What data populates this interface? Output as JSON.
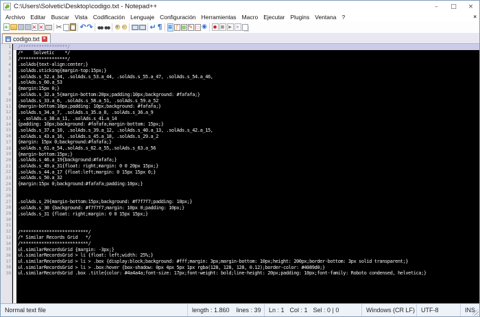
{
  "window": {
    "title": "C:\\Users\\Solvetic\\Desktop\\codigo.txt - Notepad++",
    "minimize": "–",
    "maximize": "□",
    "close": "×"
  },
  "menu": {
    "items": [
      "Archivo",
      "Editar",
      "Buscar",
      "Vista",
      "Codificación",
      "Lenguaje",
      "Configuración",
      "Herramientas",
      "Macro",
      "Ejecutar",
      "Plugins",
      "Ventana",
      "?"
    ],
    "close": "×"
  },
  "toolbar": {
    "groups": [
      [
        {
          "name": "new-file-icon",
          "type": "t-page",
          "glyph": "+",
          "color": "#2db82d"
        },
        {
          "name": "open-file-icon",
          "type": "t-folder",
          "glyph": "",
          "color": ""
        },
        {
          "name": "save-icon",
          "type": "t-floppy",
          "glyph": "",
          "color": ""
        },
        {
          "name": "save-all-icon",
          "type": "t-floppy",
          "glyph": "",
          "color": ""
        },
        {
          "name": "close-file-icon",
          "type": "t-page",
          "glyph": "×",
          "color": "#d43c3c"
        },
        {
          "name": "close-all-icon",
          "type": "t-page",
          "glyph": "×",
          "color": "#d43c3c"
        },
        {
          "name": "print-icon",
          "type": "t-printer",
          "glyph": "",
          "color": ""
        }
      ],
      [
        {
          "name": "cut-icon",
          "type": "t-plain",
          "glyph": "✂",
          "color": "#4a4f56"
        },
        {
          "name": "copy-icon",
          "type": "t-copy",
          "glyph": "",
          "color": ""
        },
        {
          "name": "paste-icon",
          "type": "t-paste",
          "glyph": "",
          "color": ""
        }
      ],
      [
        {
          "name": "undo-icon",
          "type": "t-plain",
          "glyph": "↶",
          "color": "#3a6fd8"
        },
        {
          "name": "redo-icon",
          "type": "t-plain",
          "glyph": "↷",
          "color": "#3a6fd8"
        }
      ],
      [
        {
          "name": "find-icon",
          "type": "t-binoc",
          "glyph": "",
          "color": ""
        },
        {
          "name": "replace-icon",
          "type": "t-binoc",
          "glyph": "",
          "color": ""
        }
      ],
      [
        {
          "name": "zoom-in-icon",
          "type": "t-mag",
          "glyph": "+",
          "color": "#444444"
        },
        {
          "name": "zoom-out-icon",
          "type": "t-mag",
          "glyph": "−",
          "color": "#444444"
        }
      ],
      [
        {
          "name": "sync-vertical-scroll-icon",
          "type": "t-monitor",
          "glyph": "",
          "color": ""
        },
        {
          "name": "sync-horizontal-scroll-icon",
          "type": "t-monitor",
          "glyph": "",
          "color": ""
        }
      ],
      [
        {
          "name": "word-wrap-icon",
          "type": "t-plain",
          "glyph": "↵",
          "color": "#2d6fd8"
        },
        {
          "name": "show-all-characters-icon",
          "type": "t-plain",
          "glyph": "¶",
          "color": "#2d6fd8"
        }
      ],
      [
        {
          "name": "indent-guide-icon",
          "type": "t-active",
          "glyph": "≡",
          "color": "#2d6fd8"
        },
        {
          "name": "function-list-icon",
          "type": "t-panel",
          "glyph": "ƒ",
          "color": "#e8892c"
        },
        {
          "name": "document-map-icon",
          "type": "t-panel",
          "glyph": "▦",
          "color": "#7ab648"
        },
        {
          "name": "document-switcher-icon",
          "type": "t-panel",
          "glyph": "✎",
          "color": "#d04545"
        },
        {
          "name": "folder-as-workspace-icon",
          "type": "t-panel",
          "glyph": "▭",
          "color": "#e08a8a"
        },
        {
          "name": "monitoring-icon",
          "type": "t-eye",
          "glyph": "◉",
          "color": "#2d6fd8"
        }
      ],
      [
        {
          "name": "macro-record-icon",
          "type": "t-btn",
          "glyph": "●",
          "color": "#cc2222"
        },
        {
          "name": "macro-stop-icon",
          "type": "t-btn",
          "glyph": "■",
          "color": "#9a9a9a"
        },
        {
          "name": "macro-play-icon",
          "type": "t-btn",
          "glyph": "▶",
          "color": "#7a7a7a"
        },
        {
          "name": "macro-run-multiple-icon",
          "type": "t-btn",
          "glyph": "»",
          "color": "#2d6fd8"
        },
        {
          "name": "macro-save-icon",
          "type": "t-copy",
          "glyph": "",
          "color": ""
        }
      ]
    ]
  },
  "tab": {
    "label": "codigo.txt",
    "close": "×"
  },
  "editor": {
    "current_line": 1,
    "lines": [
      "/******************/",
      "/*    Solvetic    */",
      "/******************/",
      ".solAds{text-align:center;}",
      ".solAds.sticking{margin-top:15px;}",
      ".solAds.s_52.a_34, .solAds.s_53.a_44, .solAds.s_55.a_47, .solAds.s_54.a_46,",
      ".solAds.s_60.a_53",
      "{margin:15px 0;}",
      ".solAds.s_32.a_5{margin-bottom:20px;padding:10px;background: #fafafa;}",
      ".solAds.s_33.a_6, .solAds.s_58.a_51, .solAds.s_59.a_52",
      "{margin-bottom:10px;padding: 10px;background: #fafafa;}",
      ".solAds.s_34.a_7, .solAds.s_35.a_8, .solAds.s_36.a_9",
      ", .solAds.s_38.a_11, .solAds.s_41.a_14",
      "{padding: 10px;background: #fafafa;margin-bottom: 15px;}",
      ".solAds.s_37.a_10, .solAds.s_39.a_12, .solAds.s_40.a_13, .solAds.s_42.a_15,",
      ".solAds.s_43.a_16, .solAds.s_45.a_18, .solAds.s_29.a_2",
      "{margin: 15px 0;background:#fafafa;}",
      ".solAds.s_61.a_54,.solAds.s_62.a_55,.solAds.s_63.a_56",
      "{margin-bottom:15px;}",
      ".solAds.s_46.a_19{background:#fafafa;}",
      ".solAds.s_49.a_31{float: right;margin: 0 0 20px 15px;}",
      ".solAds.s_44.a_17 {float:left;margin: 0 15px 15px 0;}",
      ".solAds.s_50.a_32",
      "{margin:15px 0;background:#fafafa;padding:10px;}",
      "",
      "",
      ".solAds.s_29{margin-bottom:15px;background: #f7f7f7;padding: 10px;}",
      ".solAds.s_30 {background: #f7f7f7;margin: 10px 0;padding: 10px;}",
      ".solAds.s_31 {float: right;margin: 0 0 15px 15px;}",
      "",
      "",
      "/**************************/",
      "/* Similar Records Grid   */",
      "/**************************/",
      "ul.similarRecordsGrid {margin: -3px;}",
      "ul.similarRecordsGrid > li {float: left;width: 25%;}",
      "ul.similarRecordsGrid > li > .box {display:block;background: #fff;margin: 3px;margin-bottom: 10px;height: 200px;border-bottom: 3px solid transparent;}",
      "ul.similarRecordsGrid > li > .box:hover {box-shadow: 0px 4px 5px 1px rgba(128, 128, 128, 0.12);border-color: #4089d0;}",
      "ul.similarRecordsGrid .box .title{color: #4a4a4a;font-size: 17px;font-weight: bold;line-height: 20px;padding: 10px;font-family: Roboto condensed, helvetica;}"
    ]
  },
  "status_bar": {
    "doc_type": "Normal text file",
    "length": "length : 1.860",
    "lines": "lines : 39",
    "line": "Ln : 1",
    "col": "Col : 1",
    "sel": "Sel : 0 | 0",
    "eol": "Windows (CR LF)",
    "encoding": "UTF-8",
    "insert_mode": "INS"
  },
  "colors": {
    "editor_bg": "#000000",
    "editor_text": "#f2f2f2",
    "current_line_highlight": "#ccccea",
    "active_tab_accent": "#e8a33c"
  }
}
